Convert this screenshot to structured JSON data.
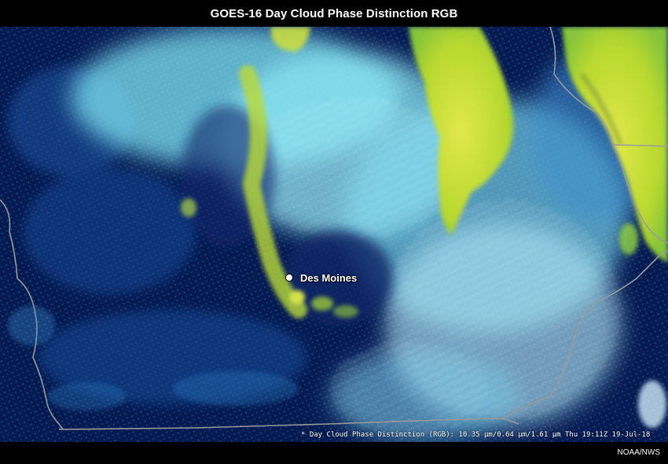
{
  "title": "GOES-16 Day Cloud Phase Distinction RGB",
  "city": {
    "name": "Des Moines"
  },
  "caption": "* Day Cloud Phase Distinction (RGB): 10.35 µm/0.64 µm/1.61 µm Thu 19:11Z 19-Jul-18",
  "credit": "NOAA/NWS",
  "colors": {
    "background_land": "#061a52",
    "ice_clouds": "#3fd2e8",
    "water_clouds": "#d8eef7",
    "thick_cloud": "#c8e23a",
    "boundary": "#9a9a9a"
  }
}
